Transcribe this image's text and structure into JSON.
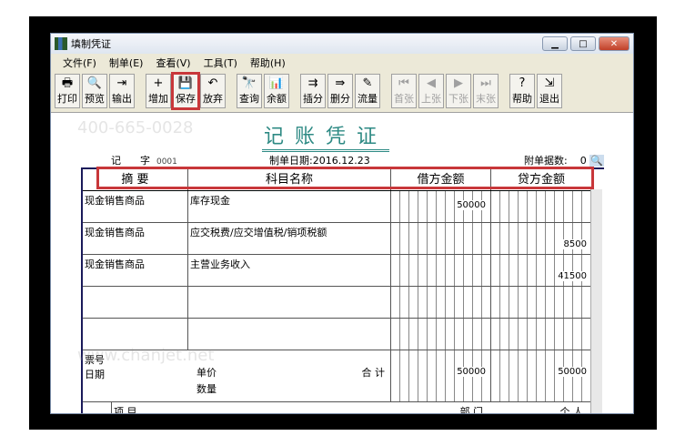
{
  "window": {
    "title": "填制凭证",
    "controls": [
      "▁",
      "□",
      "✕"
    ]
  },
  "menu": [
    "文件(F)",
    "制单(E)",
    "查看(V)",
    "工具(T)",
    "帮助(H)"
  ],
  "toolbar": [
    {
      "label": "打印",
      "icon": "🖶"
    },
    {
      "label": "预览",
      "icon": "🔍"
    },
    {
      "label": "输出",
      "icon": "⇥"
    },
    {
      "label": "增加",
      "icon": "+"
    },
    {
      "label": "保存",
      "icon": "💾"
    },
    {
      "label": "放弃",
      "icon": "↶"
    },
    {
      "label": "查询",
      "icon": "🔭"
    },
    {
      "label": "余额",
      "icon": "📊"
    },
    {
      "label": "插分",
      "icon": "⇉"
    },
    {
      "label": "删分",
      "icon": "⇛"
    },
    {
      "label": "流量",
      "icon": "✎"
    },
    {
      "label": "首张",
      "icon": "⏮"
    },
    {
      "label": "上张",
      "icon": "◀"
    },
    {
      "label": "下张",
      "icon": "▶"
    },
    {
      "label": "末张",
      "icon": "⏭"
    },
    {
      "label": "帮助",
      "icon": "?"
    },
    {
      "label": "退出",
      "icon": "⇲"
    }
  ],
  "voucher": {
    "title": "记账凭证",
    "type": "记",
    "type_label": "字",
    "number": "0001",
    "date_label": "制单日期:",
    "date": "2016.12.23",
    "attach_label": "附单据数:",
    "attach": "0"
  },
  "headers": [
    "摘 要",
    "科目名称",
    "借方金额",
    "贷方金额"
  ],
  "rows": [
    {
      "summary": "现金销售商品",
      "account": "库存现金",
      "debit": "50000",
      "credit": ""
    },
    {
      "summary": "现金销售商品",
      "account": "应交税费/应交增值税/销项税额",
      "debit": "",
      "credit": "8500"
    },
    {
      "summary": "现金销售商品",
      "account": "主营业务收入",
      "debit": "",
      "credit": "41500"
    }
  ],
  "footer": {
    "ticket": "票号",
    "date": "日期",
    "price": "单价",
    "qty": "数量",
    "total_label": "合 计",
    "debit_total": "50000",
    "credit_total": "50000",
    "project": "项 目",
    "dept": "部 门",
    "person": "个 人"
  },
  "watermarks": [
    "400-665-0028",
    "www.chanjet.net"
  ]
}
